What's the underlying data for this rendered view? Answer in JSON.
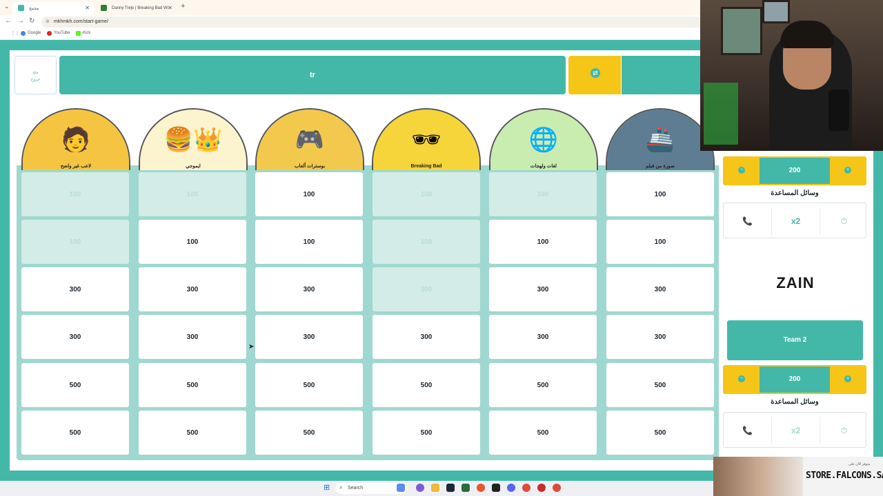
{
  "browser": {
    "tabs": [
      {
        "title": "مخمخ",
        "active": true
      },
      {
        "title": "Danny Trejo | Breaking Bad Wi",
        "active": false
      }
    ],
    "url": "mkhmkh.com/start-game/",
    "bookmarks": [
      "Google",
      "YouTube",
      "Kick"
    ]
  },
  "game": {
    "exit_label": "خروج",
    "current_team": "tr",
    "categories": [
      {
        "name": "لاعب غير واضح",
        "icon": "person-blurred-icon"
      },
      {
        "name": "ايموجي",
        "icon": "burger-crown-icon"
      },
      {
        "name": "بوسترات ألعاب",
        "icon": "game-poster-icon"
      },
      {
        "name": "Breaking Bad",
        "icon": "sunglasses-icon"
      },
      {
        "name": "لغات ولهجات",
        "icon": "globe-language-icon"
      },
      {
        "name": "صورة من فيلم",
        "icon": "ship-icon"
      }
    ],
    "board": [
      [
        {
          "v": "100",
          "used": true
        },
        {
          "v": "100",
          "used": true
        },
        {
          "v": "100",
          "used": false
        },
        {
          "v": "100",
          "used": true
        },
        {
          "v": "100",
          "used": true
        },
        {
          "v": "100",
          "used": false
        }
      ],
      [
        {
          "v": "100",
          "used": true
        },
        {
          "v": "100",
          "used": false
        },
        {
          "v": "100",
          "used": false
        },
        {
          "v": "100",
          "used": true
        },
        {
          "v": "100",
          "used": false
        },
        {
          "v": "100",
          "used": false
        }
      ],
      [
        {
          "v": "300",
          "used": false
        },
        {
          "v": "300",
          "used": false
        },
        {
          "v": "300",
          "used": false
        },
        {
          "v": "300",
          "used": true
        },
        {
          "v": "300",
          "used": false
        },
        {
          "v": "300",
          "used": false
        }
      ],
      [
        {
          "v": "300",
          "used": false
        },
        {
          "v": "300",
          "used": false
        },
        {
          "v": "300",
          "used": false
        },
        {
          "v": "300",
          "used": false
        },
        {
          "v": "300",
          "used": false
        },
        {
          "v": "300",
          "used": false
        }
      ],
      [
        {
          "v": "500",
          "used": false
        },
        {
          "v": "500",
          "used": false
        },
        {
          "v": "500",
          "used": false
        },
        {
          "v": "500",
          "used": false
        },
        {
          "v": "500",
          "used": false
        },
        {
          "v": "500",
          "used": false
        }
      ],
      [
        {
          "v": "500",
          "used": false
        },
        {
          "v": "500",
          "used": false
        },
        {
          "v": "500",
          "used": false
        },
        {
          "v": "500",
          "used": false
        },
        {
          "v": "500",
          "used": false
        },
        {
          "v": "500",
          "used": false
        }
      ]
    ]
  },
  "panel": {
    "team1": {
      "score": "200",
      "help_label": "وسائل المساعدة",
      "aids": [
        "phone-icon",
        "x2",
        "clock-icon"
      ]
    },
    "sponsor": "ZAIN",
    "team2": {
      "name": "Team 2",
      "score": "200",
      "help_label": "وسائل المساعدة",
      "aids": [
        "phone-icon",
        "x2",
        "clock-icon"
      ]
    }
  },
  "promo": {
    "brand": "STORE.FALCONS.SA",
    "small": "متوفر الآن على"
  },
  "taskbar": {
    "search": "Search"
  },
  "colors": {
    "teal": "#44b8a8",
    "yellow": "#f5c518",
    "used_cell": "#d3ece8"
  }
}
